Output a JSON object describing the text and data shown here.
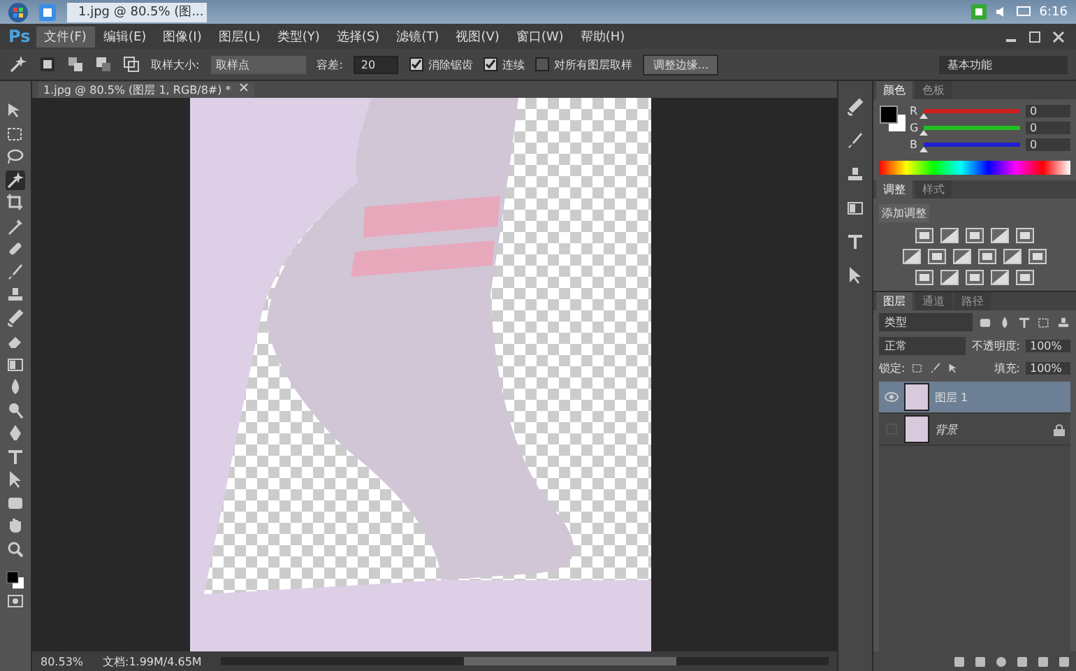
{
  "taskbar": {
    "task_label": "1.jpg @ 80.5% (图...",
    "time": "6:16"
  },
  "app_logo": "Ps",
  "menu": [
    {
      "label": "文件(F)",
      "selected": true
    },
    {
      "label": "编辑(E)",
      "selected": false
    },
    {
      "label": "图像(I)",
      "selected": false
    },
    {
      "label": "图层(L)",
      "selected": false
    },
    {
      "label": "类型(Y)",
      "selected": false
    },
    {
      "label": "选择(S)",
      "selected": false
    },
    {
      "label": "滤镜(T)",
      "selected": false
    },
    {
      "label": "视图(V)",
      "selected": false
    },
    {
      "label": "窗口(W)",
      "selected": false
    },
    {
      "label": "帮助(H)",
      "selected": false
    }
  ],
  "options_bar": {
    "sample_size_label": "取样大小:",
    "sample_size_value": "取样点",
    "tolerance_label": "容差:",
    "tolerance_value": "20",
    "checks": [
      {
        "label": "消除锯齿",
        "checked": true
      },
      {
        "label": "连续",
        "checked": true
      },
      {
        "label": "对所有图层取样",
        "checked": false
      }
    ],
    "refine_button": "调整边缘...",
    "workspace": "基本功能"
  },
  "tools": [
    {
      "kind": "move",
      "selected": false
    },
    {
      "kind": "marquee",
      "selected": false
    },
    {
      "kind": "lasso",
      "selected": false
    },
    {
      "kind": "wand",
      "selected": true
    },
    {
      "kind": "crop",
      "selected": false
    },
    {
      "kind": "eyedropper",
      "selected": false
    },
    {
      "kind": "heal",
      "selected": false
    },
    {
      "kind": "brush",
      "selected": false
    },
    {
      "kind": "stamp",
      "selected": false
    },
    {
      "kind": "history",
      "selected": false
    },
    {
      "kind": "eraser",
      "selected": false
    },
    {
      "kind": "gradient",
      "selected": false
    },
    {
      "kind": "blur",
      "selected": false
    },
    {
      "kind": "dodge",
      "selected": false
    },
    {
      "kind": "pen",
      "selected": false
    },
    {
      "kind": "type",
      "selected": false
    },
    {
      "kind": "path",
      "selected": false
    },
    {
      "kind": "shape",
      "selected": false
    },
    {
      "kind": "hand",
      "selected": false
    },
    {
      "kind": "zoom",
      "selected": false
    }
  ],
  "document": {
    "tab_title": "1.jpg @ 80.5% (图层 1, RGB/8#) *",
    "zoom": "80.53%",
    "doc_info": "文档:1.99M/4.65M"
  },
  "color_panel": {
    "tabs": [
      {
        "label": "颜色",
        "selected": true
      },
      {
        "label": "色板",
        "selected": false
      }
    ],
    "channels": [
      {
        "name": "R",
        "level": 0,
        "value": "0",
        "color": "#d02020"
      },
      {
        "name": "G",
        "level": 0,
        "value": "0",
        "color": "#20c020"
      },
      {
        "name": "B",
        "level": 0,
        "value": "0",
        "color": "#2020d0"
      }
    ]
  },
  "adjustments_panel": {
    "tabs": [
      {
        "label": "调整",
        "selected": true
      },
      {
        "label": "样式",
        "selected": false
      }
    ],
    "heading": "添加调整"
  },
  "layers_panel": {
    "tabs": [
      {
        "label": "图层",
        "selected": true
      },
      {
        "label": "通道",
        "selected": false
      },
      {
        "label": "路径",
        "selected": false
      }
    ],
    "filter": "类型",
    "blend_mode": "正常",
    "opacity_label": "不透明度:",
    "opacity": "100%",
    "lock_label": "锁定:",
    "fill_label": "填充:",
    "fill": "100%",
    "layers": [
      {
        "name": "图层 1",
        "selected": true,
        "visible": true,
        "locked": false
      },
      {
        "name": "背景",
        "selected": false,
        "visible": false,
        "locked": true
      }
    ]
  }
}
